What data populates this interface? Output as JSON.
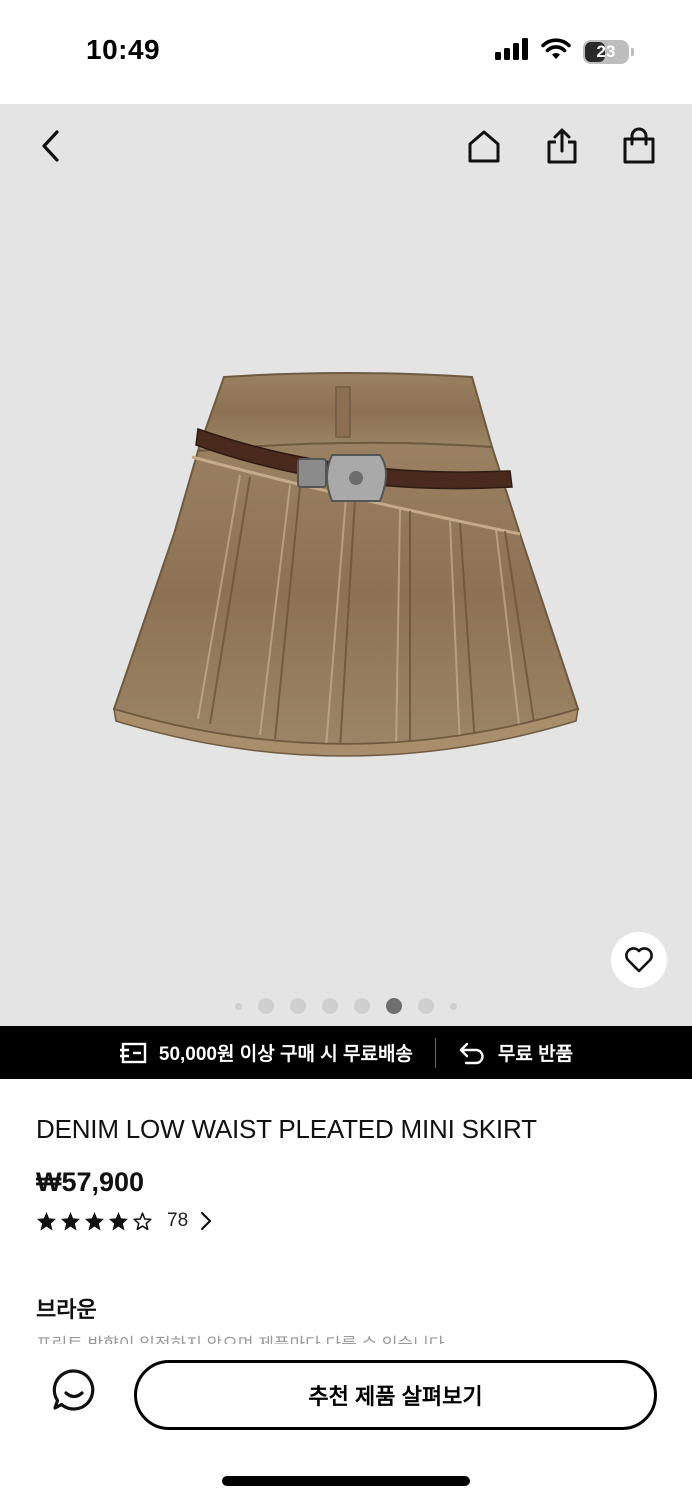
{
  "status_bar": {
    "time": "10:49",
    "battery": "23",
    "icons": [
      "signal-icon",
      "wifi-icon",
      "battery-icon"
    ]
  },
  "header": {
    "icons": [
      "back-icon",
      "home-icon",
      "share-icon",
      "shopping-bag-icon"
    ]
  },
  "gallery": {
    "dot_count": 8,
    "active_index": 5,
    "wishlist_icon": "heart-icon"
  },
  "promo": {
    "shipping_icon": "delivery-truck-icon",
    "shipping_text": "50,000원 이상 구매 시 무료배송",
    "return_icon": "return-arrow-icon",
    "return_text": "무료 반품"
  },
  "product": {
    "name": "DENIM LOW WAIST PLEATED MINI SKIRT",
    "price": "₩57,900",
    "rating": 4.5,
    "review_count": "78",
    "color_label": "브라운",
    "color_note": "프린트 방향이 일정하지 않으며 제품마다 다를 수 있습니다"
  },
  "bottom": {
    "chat_icon": "chat-bubble-icon",
    "cta_label": "추천 제품 살펴보기"
  }
}
